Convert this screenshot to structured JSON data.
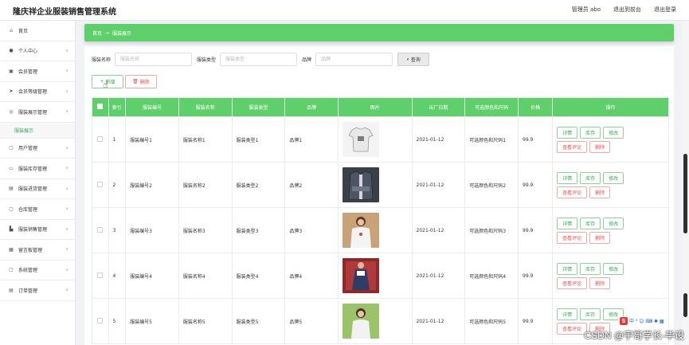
{
  "app": {
    "title": "隆庆祥企业服装销售管理系统"
  },
  "topbar": {
    "admin_label": "管理员 abo",
    "front_label": "退出到前台",
    "logout_label": "退出登录"
  },
  "sidebar": {
    "items": [
      {
        "label": "首页",
        "icon": "home-icon",
        "glyph": "⌂"
      },
      {
        "label": "个人中心",
        "icon": "user-icon",
        "glyph": "●"
      },
      {
        "label": "会员管理",
        "icon": "member-icon",
        "glyph": "▣"
      },
      {
        "label": "会员等级管理",
        "icon": "send-icon",
        "glyph": "➤"
      },
      {
        "label": "服装展示管理",
        "icon": "circle-icon",
        "glyph": "◎"
      }
    ],
    "sub_item": "服装展示",
    "items2": [
      {
        "label": "用户管理",
        "icon": "user-manage-icon",
        "glyph": "▢"
      },
      {
        "label": "服装库存管理",
        "icon": "chat-icon",
        "glyph": "▭"
      },
      {
        "label": "服装进货管理",
        "icon": "card-icon",
        "glyph": "▤"
      },
      {
        "label": "仓库管理",
        "icon": "warehouse-icon",
        "glyph": "▢"
      },
      {
        "label": "服装销售管理",
        "icon": "flag-icon",
        "glyph": "▙"
      },
      {
        "label": "留言板管理",
        "icon": "board-icon",
        "glyph": "▦"
      },
      {
        "label": "系统管理",
        "icon": "system-icon",
        "glyph": "▢"
      },
      {
        "label": "订单管理",
        "icon": "order-icon",
        "glyph": "▤"
      }
    ]
  },
  "breadcrumb": {
    "home": "首页",
    "arrow": "→",
    "current": "服装展示"
  },
  "search": {
    "name_label": "服装名称",
    "name_placeholder": "服装名称",
    "type_label": "服装类型",
    "type_placeholder": "服装类型",
    "brand_label": "品牌",
    "brand_placeholder": "品牌",
    "search_button": "查询"
  },
  "actions": {
    "add_label": "新增",
    "delete_label": "删除"
  },
  "table": {
    "headers": {
      "index": "索引",
      "code": "服装编号",
      "name": "服装名称",
      "type": "服装类型",
      "brand": "品牌",
      "image": "图片",
      "date": "出厂日期",
      "colors": "可选颜色和尺码",
      "price": "价格",
      "ops": "操作"
    },
    "ops": {
      "detail": "详情",
      "stock": "库存",
      "edit": "修改",
      "review": "查看评论",
      "delete": "删除"
    },
    "rows": [
      {
        "index": "1",
        "code": "服装编号1",
        "name": "服装名称1",
        "type": "服装类型1",
        "brand": "品牌1",
        "date": "2021-01-12",
        "colors": "可选颜色和尺码1",
        "price": "99.9"
      },
      {
        "index": "2",
        "code": "服装编号2",
        "name": "服装名称2",
        "type": "服装类型2",
        "brand": "品牌2",
        "date": "2021-01-12",
        "colors": "可选颜色和尺码2",
        "price": "99.9"
      },
      {
        "index": "3",
        "code": "服装编号3",
        "name": "服装名称3",
        "type": "服装类型3",
        "brand": "品牌3",
        "date": "2021-01-12",
        "colors": "可选颜色和尺码3",
        "price": "99.9"
      },
      {
        "index": "4",
        "code": "服装编号4",
        "name": "服装名称4",
        "type": "服装类型4",
        "brand": "品牌4",
        "date": "2021-01-12",
        "colors": "可选颜色和尺码4",
        "price": "99.9"
      },
      {
        "index": "5",
        "code": "服装编号5",
        "name": "服装名称5",
        "type": "服装类型5",
        "brand": "品牌5",
        "date": "2021-01-12",
        "colors": "可选颜色和尺码5",
        "price": "99.9"
      }
    ]
  },
  "tray": {
    "s_label": "S",
    "text": "中 ⁵ ☺ ⌨ ✱ ▦"
  },
  "watermark": "CSDN @宇哥学长-毕设",
  "colors": {
    "accent": "#5fcf6b",
    "green_text": "#34a853",
    "red_text": "#e05050"
  }
}
